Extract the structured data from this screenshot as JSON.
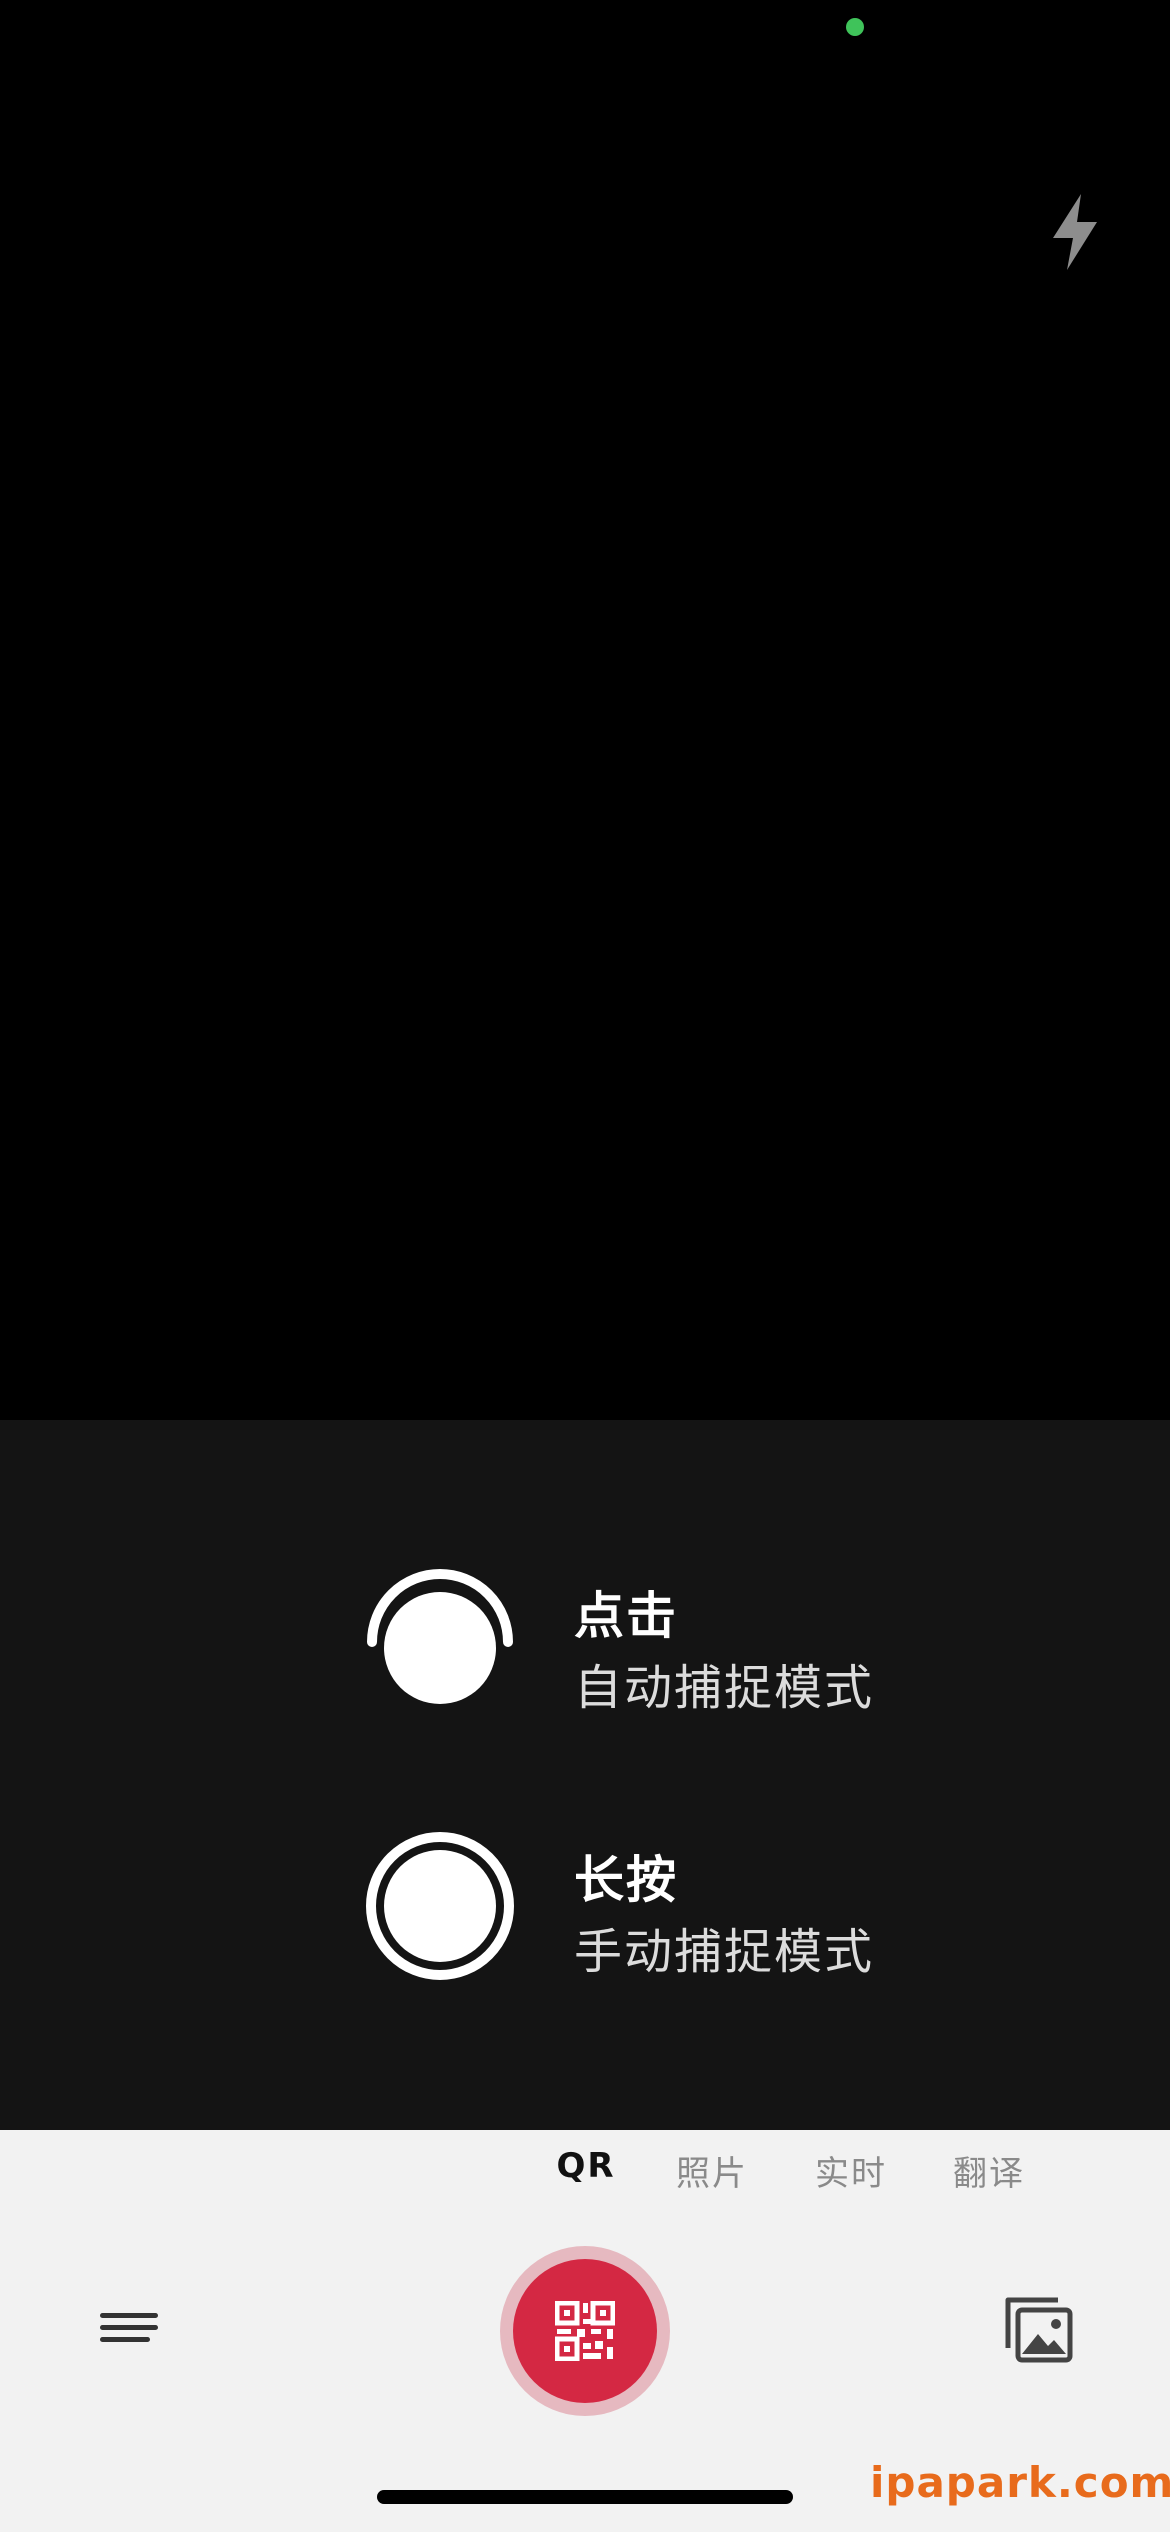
{
  "status": {
    "privacy_indicator_color": "#3fc35a"
  },
  "viewfinder": {
    "flash_icon": "lightning-bolt-icon"
  },
  "hints": [
    {
      "title": "点击",
      "subtitle": "自动捕捉模式",
      "icon": "tap-auto-capture-icon"
    },
    {
      "title": "长按",
      "subtitle": "手动捕捉模式",
      "icon": "hold-manual-capture-icon"
    }
  ],
  "mode_tabs": [
    {
      "label": "QR",
      "active": true
    },
    {
      "label": "照片",
      "active": false
    },
    {
      "label": "实时",
      "active": false
    },
    {
      "label": "翻译",
      "active": false
    }
  ],
  "toolbar": {
    "menu_icon": "menu-lines-icon",
    "shutter_icon": "qr-code-icon",
    "gallery_icon": "gallery-images-icon",
    "accent_color": "#d42843"
  },
  "watermark": "ipapark.com"
}
